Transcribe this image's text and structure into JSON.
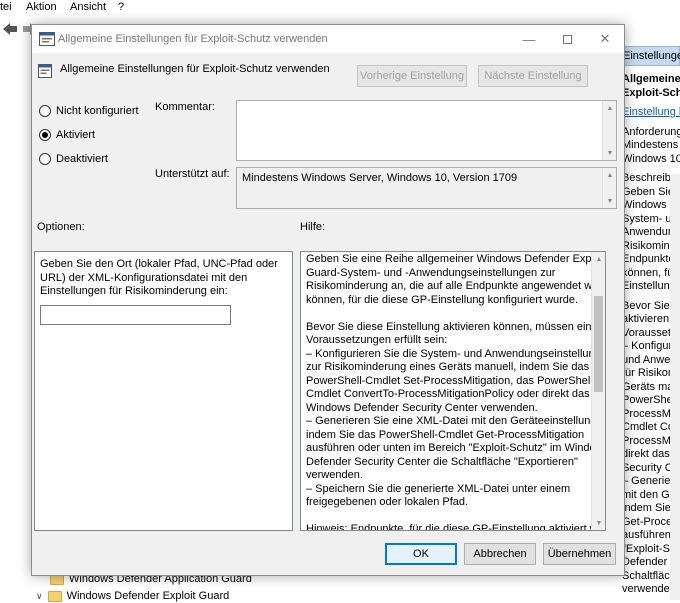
{
  "background": {
    "menu": [
      "tei",
      "Aktion",
      "Ansicht",
      "?"
    ],
    "right_pane": {
      "header": "Einstellungen für Exploit-Schutz",
      "lines": [
        {
          "text": "Allgemeine Einstell",
          "style": "bold"
        },
        {
          "text": "Exploit-Schutz verw",
          "style": "bold"
        },
        {
          "text": "Einstellung bearbeiten",
          "style": "link"
        },
        {
          "text": "Anforderungen:",
          "style": "normal"
        },
        {
          "text": "Mindestens Windows",
          "style": "normal"
        },
        {
          "text": "Windows 10, Version",
          "style": "normal"
        },
        {
          "text": "Beschreibung:",
          "style": "normal"
        },
        {
          "text": "Geben Sie eine Reihe",
          "style": "normal"
        },
        {
          "text": "Windows Defender E",
          "style": "normal"
        },
        {
          "text": "System- und -",
          "style": "normal"
        },
        {
          "text": "Anwendungseinstell",
          "style": "normal"
        },
        {
          "text": "Risikominderung an,",
          "style": "normal"
        },
        {
          "text": "Endpunkte angewend",
          "style": "normal"
        },
        {
          "text": "können, für die diese",
          "style": "normal"
        },
        {
          "text": "Einstellung konfigurie",
          "style": "normal"
        },
        {
          "text": "Bevor Sie diese Einst",
          "style": "normal"
        },
        {
          "text": "aktivieren können, m",
          "style": "normal"
        },
        {
          "text": "Voraussetzungen erf",
          "style": "normal"
        },
        {
          "text": "– Konfigurieren Sie d",
          "style": "normal"
        },
        {
          "text": "und Anwendungsein",
          "style": "normal"
        },
        {
          "text": "für Risikominderung",
          "style": "normal"
        },
        {
          "text": "Geräts manuell, inde",
          "style": "normal"
        },
        {
          "text": "PowerShell-Cmdlet S",
          "style": "normal"
        },
        {
          "text": "ProcessMitigation, da",
          "style": "normal"
        },
        {
          "text": "Cmdlet ConvertTo-",
          "style": "normal"
        },
        {
          "text": "ProcessMitigationPol",
          "style": "normal"
        },
        {
          "text": "direkt das Windows D",
          "style": "normal"
        },
        {
          "text": "Security Center verw",
          "style": "normal"
        },
        {
          "text": "– Generieren Sie eine",
          "style": "normal"
        },
        {
          "text": "mit den Geräteeinst",
          "style": "normal"
        },
        {
          "text": "indem Sie das Power",
          "style": "normal"
        },
        {
          "text": "Get-ProcessMitigatio",
          "style": "normal"
        },
        {
          "text": "ausführen oder unten",
          "style": "normal"
        },
        {
          "text": "\"Exploit-Schutz\" im W",
          "style": "normal"
        },
        {
          "text": "Defender Security Ce",
          "style": "normal"
        },
        {
          "text": "Schaltfläche \"Exporti",
          "style": "normal"
        },
        {
          "text": "verwenden.",
          "style": "normal"
        }
      ]
    },
    "tree": [
      {
        "label": "Windows Defender Application Guard"
      },
      {
        "label": "Windows Defender Exploit Guard"
      }
    ]
  },
  "dialog": {
    "title": "Allgemeine Einstellungen für Exploit-Schutz verwenden",
    "header_title": "Allgemeine Einstellungen für Exploit-Schutz verwenden",
    "prev_button": "Vorherige Einstellung",
    "next_button": "Nächste Einstellung",
    "radios": [
      {
        "label": "Nicht konfiguriert",
        "checked": false
      },
      {
        "label": "Aktiviert",
        "checked": true
      },
      {
        "label": "Deaktiviert",
        "checked": false
      }
    ],
    "comment_label": "Kommentar:",
    "comment_value": "",
    "supported_label": "Unterstützt auf:",
    "supported_value": "Mindestens Windows Server, Windows 10, Version 1709",
    "options_label": "Optionen:",
    "help_label": "Hilfe:",
    "options_text": [
      "Geben Sie den Ort (lokaler Pfad, UNC-Pfad oder",
      "URL) der XML-Konfigurationsdatei mit den",
      "Einstellungen für Risikominderung ein:"
    ],
    "options_input_value": "",
    "help_text": [
      "Geben Sie eine Reihe allgemeiner Windows Defender Exploit",
      "Guard-System- und -Anwendungseinstellungen zur",
      "Risikominderung an, die auf alle Endpunkte angewendet werden",
      "können, für die diese GP-Einstellung konfiguriert wurde.",
      "",
      "Bevor Sie diese Einstellung aktivieren können, müssen einige",
      "Voraussetzungen erfüllt sein:",
      "– Konfigurieren Sie die System- und Anwendungseinstellungen",
      "zur Risikominderung eines Geräts manuell, indem Sie das",
      "PowerShell-Cmdlet Set-ProcessMitigation, das PowerShell-",
      "Cmdlet ConvertTo-ProcessMitigationPolicy oder direkt das",
      "Windows Defender Security Center verwenden.",
      "– Generieren Sie eine XML-Datei mit den Geräteeinstellungen,",
      "indem Sie das PowerShell-Cmdlet Get-ProcessMitigation",
      "ausführen oder unten im Bereich \"Exploit-Schutz\" im Windows",
      "Defender Security Center die Schaltfläche \"Exportieren\"",
      "verwenden.",
      "– Speichern Sie die generierte XML-Datei unter einem",
      "freigegebenen oder lokalen Pfad.",
      "",
      "Hinweis: Endpunkte, für die diese GP-Einstellung aktiviert wurde,"
    ],
    "ok_button": "OK",
    "cancel_button": "Abbrechen",
    "apply_button": "Übernehmen"
  },
  "colors": {
    "dialog_bg": "#f0f0f0",
    "accent": "#0078d7",
    "link": "#0b5fb8",
    "folder": "#f3d273"
  }
}
